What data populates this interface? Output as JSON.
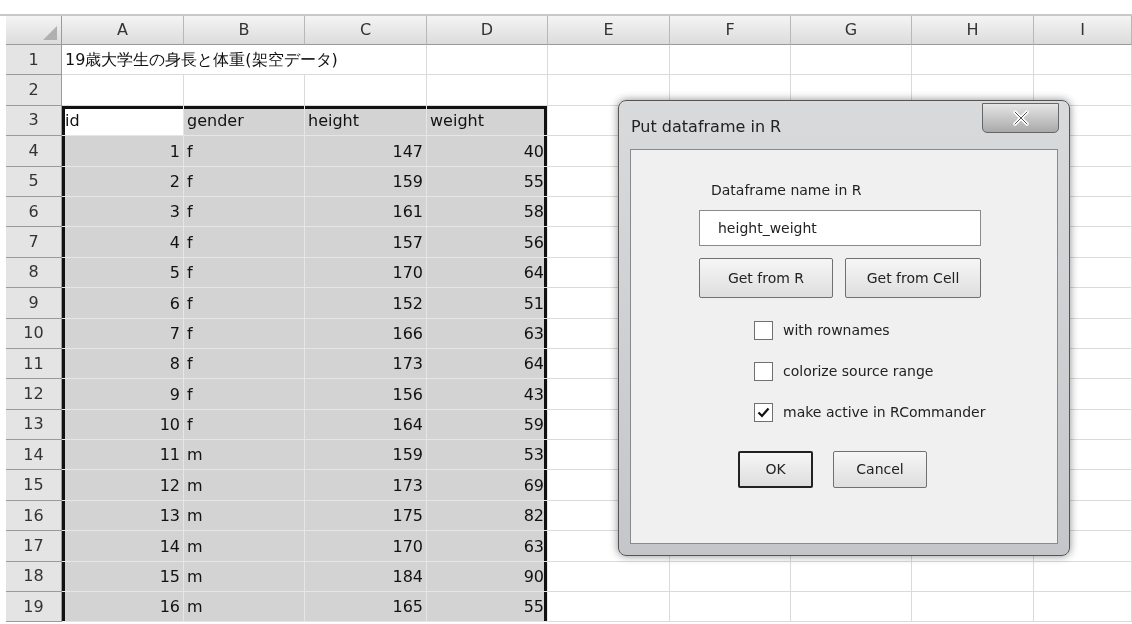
{
  "columns": [
    "A",
    "B",
    "C",
    "D",
    "E",
    "F",
    "G",
    "H",
    "I"
  ],
  "rows": [
    {
      "number": "1",
      "cells": [
        {
          "text": "19歳大学生の身長と体重(架空データ)",
          "kind": "text",
          "selected": false
        }
      ]
    },
    {
      "number": "2"
    },
    {
      "number": "3",
      "cells": [
        {
          "text": "id",
          "kind": "text",
          "selected": true,
          "active": true
        },
        {
          "text": "gender",
          "kind": "text",
          "selected": true,
          "active": false
        },
        {
          "text": "height",
          "kind": "text",
          "selected": true,
          "active": false
        },
        {
          "text": "weight",
          "kind": "text",
          "selected": true,
          "active": false
        }
      ]
    },
    {
      "number": "4",
      "cells": [
        {
          "text": "1",
          "kind": "number",
          "selected": true,
          "active": false
        },
        {
          "text": "f",
          "kind": "text",
          "selected": true,
          "active": false
        },
        {
          "text": "147",
          "kind": "number",
          "selected": true,
          "active": false
        },
        {
          "text": "40",
          "kind": "number",
          "selected": true,
          "active": false
        }
      ]
    },
    {
      "number": "5",
      "cells": [
        {
          "text": "2",
          "kind": "number",
          "selected": true,
          "active": false
        },
        {
          "text": "f",
          "kind": "text",
          "selected": true,
          "active": false
        },
        {
          "text": "159",
          "kind": "number",
          "selected": true,
          "active": false
        },
        {
          "text": "55",
          "kind": "number",
          "selected": true,
          "active": false
        }
      ]
    },
    {
      "number": "6",
      "cells": [
        {
          "text": "3",
          "kind": "number",
          "selected": true,
          "active": false
        },
        {
          "text": "f",
          "kind": "text",
          "selected": true,
          "active": false
        },
        {
          "text": "161",
          "kind": "number",
          "selected": true,
          "active": false
        },
        {
          "text": "58",
          "kind": "number",
          "selected": true,
          "active": false
        }
      ]
    },
    {
      "number": "7",
      "cells": [
        {
          "text": "4",
          "kind": "number",
          "selected": true,
          "active": false
        },
        {
          "text": "f",
          "kind": "text",
          "selected": true,
          "active": false
        },
        {
          "text": "157",
          "kind": "number",
          "selected": true,
          "active": false
        },
        {
          "text": "56",
          "kind": "number",
          "selected": true,
          "active": false
        }
      ]
    },
    {
      "number": "8",
      "cells": [
        {
          "text": "5",
          "kind": "number",
          "selected": true,
          "active": false
        },
        {
          "text": "f",
          "kind": "text",
          "selected": true,
          "active": false
        },
        {
          "text": "170",
          "kind": "number",
          "selected": true,
          "active": false
        },
        {
          "text": "64",
          "kind": "number",
          "selected": true,
          "active": false
        }
      ]
    },
    {
      "number": "9",
      "cells": [
        {
          "text": "6",
          "kind": "number",
          "selected": true,
          "active": false
        },
        {
          "text": "f",
          "kind": "text",
          "selected": true,
          "active": false
        },
        {
          "text": "152",
          "kind": "number",
          "selected": true,
          "active": false
        },
        {
          "text": "51",
          "kind": "number",
          "selected": true,
          "active": false
        }
      ]
    },
    {
      "number": "10",
      "cells": [
        {
          "text": "7",
          "kind": "number",
          "selected": true,
          "active": false
        },
        {
          "text": "f",
          "kind": "text",
          "selected": true,
          "active": false
        },
        {
          "text": "166",
          "kind": "number",
          "selected": true,
          "active": false
        },
        {
          "text": "63",
          "kind": "number",
          "selected": true,
          "active": false
        }
      ]
    },
    {
      "number": "11",
      "cells": [
        {
          "text": "8",
          "kind": "number",
          "selected": true,
          "active": false
        },
        {
          "text": "f",
          "kind": "text",
          "selected": true,
          "active": false
        },
        {
          "text": "173",
          "kind": "number",
          "selected": true,
          "active": false
        },
        {
          "text": "64",
          "kind": "number",
          "selected": true,
          "active": false
        }
      ]
    },
    {
      "number": "12",
      "cells": [
        {
          "text": "9",
          "kind": "number",
          "selected": true,
          "active": false
        },
        {
          "text": "f",
          "kind": "text",
          "selected": true,
          "active": false
        },
        {
          "text": "156",
          "kind": "number",
          "selected": true,
          "active": false
        },
        {
          "text": "43",
          "kind": "number",
          "selected": true,
          "active": false
        }
      ]
    },
    {
      "number": "13",
      "cells": [
        {
          "text": "10",
          "kind": "number",
          "selected": true,
          "active": false
        },
        {
          "text": "f",
          "kind": "text",
          "selected": true,
          "active": false
        },
        {
          "text": "164",
          "kind": "number",
          "selected": true,
          "active": false
        },
        {
          "text": "59",
          "kind": "number",
          "selected": true,
          "active": false
        }
      ]
    },
    {
      "number": "14",
      "cells": [
        {
          "text": "11",
          "kind": "number",
          "selected": true,
          "active": false
        },
        {
          "text": "m",
          "kind": "text",
          "selected": true,
          "active": false
        },
        {
          "text": "159",
          "kind": "number",
          "selected": true,
          "active": false
        },
        {
          "text": "53",
          "kind": "number",
          "selected": true,
          "active": false
        }
      ]
    },
    {
      "number": "15",
      "cells": [
        {
          "text": "12",
          "kind": "number",
          "selected": true,
          "active": false
        },
        {
          "text": "m",
          "kind": "text",
          "selected": true,
          "active": false
        },
        {
          "text": "173",
          "kind": "number",
          "selected": true,
          "active": false
        },
        {
          "text": "69",
          "kind": "number",
          "selected": true,
          "active": false
        }
      ]
    },
    {
      "number": "16",
      "cells": [
        {
          "text": "13",
          "kind": "number",
          "selected": true,
          "active": false
        },
        {
          "text": "m",
          "kind": "text",
          "selected": true,
          "active": false
        },
        {
          "text": "175",
          "kind": "number",
          "selected": true,
          "active": false
        },
        {
          "text": "82",
          "kind": "number",
          "selected": true,
          "active": false
        }
      ]
    },
    {
      "number": "17",
      "cells": [
        {
          "text": "14",
          "kind": "number",
          "selected": true,
          "active": false
        },
        {
          "text": "m",
          "kind": "text",
          "selected": true,
          "active": false
        },
        {
          "text": "170",
          "kind": "number",
          "selected": true,
          "active": false
        },
        {
          "text": "63",
          "kind": "number",
          "selected": true,
          "active": false
        }
      ]
    },
    {
      "number": "18",
      "cells": [
        {
          "text": "15",
          "kind": "number",
          "selected": true,
          "active": false
        },
        {
          "text": "m",
          "kind": "text",
          "selected": true,
          "active": false
        },
        {
          "text": "184",
          "kind": "number",
          "selected": true,
          "active": false
        },
        {
          "text": "90",
          "kind": "number",
          "selected": true,
          "active": false
        }
      ]
    },
    {
      "number": "19",
      "cells": [
        {
          "text": "16",
          "kind": "number",
          "selected": true,
          "active": false
        },
        {
          "text": "m",
          "kind": "text",
          "selected": true,
          "active": false
        },
        {
          "text": "165",
          "kind": "number",
          "selected": true,
          "active": false
        },
        {
          "text": "55",
          "kind": "number",
          "selected": true,
          "active": false
        }
      ]
    }
  ],
  "dialog": {
    "title": "Put dataframe in R",
    "field_label": "Dataframe name in R",
    "field": {
      "value": "height_weight"
    },
    "buttons": [
      {
        "label": "Get from R"
      },
      {
        "label": "Get from Cell"
      }
    ],
    "checkboxes": [
      {
        "label": "with rownames",
        "checked": false
      },
      {
        "label": "colorize source range",
        "checked": false
      },
      {
        "label": "make active in RCommander",
        "checked": true
      }
    ],
    "actions": [
      {
        "label": "OK",
        "default": true
      },
      {
        "label": "Cancel",
        "default": false
      }
    ]
  }
}
